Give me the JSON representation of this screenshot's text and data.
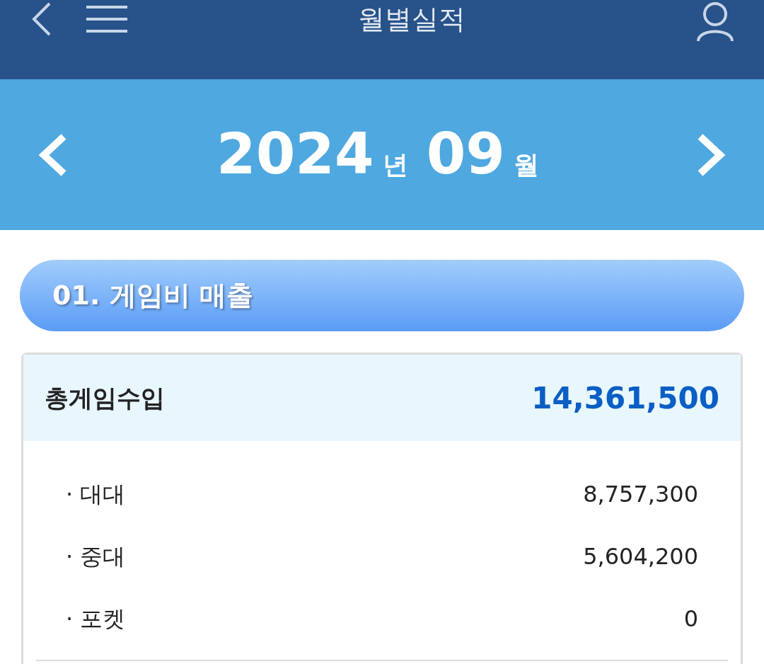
{
  "header": {
    "title": "월별실적"
  },
  "month_bar": {
    "year": "2024",
    "year_unit": "년",
    "month": "09",
    "month_unit": "월"
  },
  "section": {
    "title": "01. 게임비 매출"
  },
  "summary": {
    "label": "총게임수입",
    "value": "14,361,500"
  },
  "rows": [
    {
      "label": "· 대대",
      "value": "8,757,300"
    },
    {
      "label": "· 중대",
      "value": "5,604,200"
    },
    {
      "label": "· 포켓",
      "value": "0"
    }
  ]
}
